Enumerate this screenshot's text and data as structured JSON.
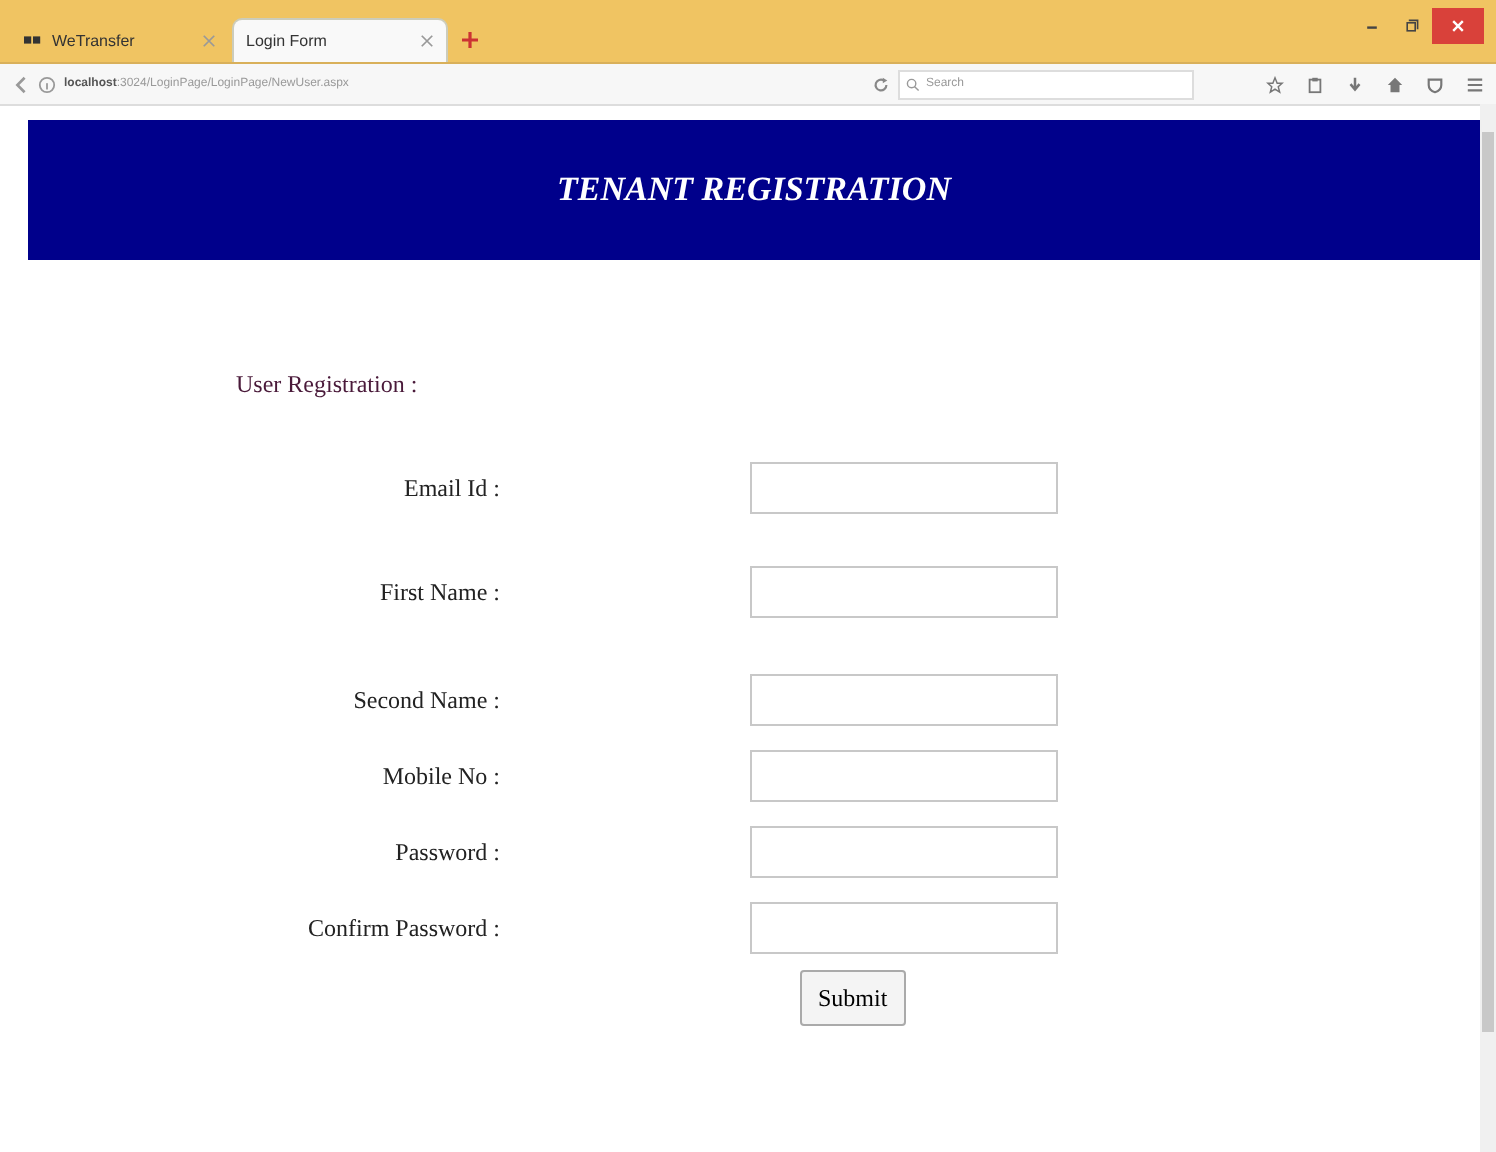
{
  "browser": {
    "tabs": [
      {
        "label": "WeTransfer",
        "selected": false
      },
      {
        "label": "Login Form",
        "selected": true
      }
    ],
    "address": {
      "host": "localhost",
      "path": ":3024/LoginPage/LoginPage/NewUser.aspx"
    },
    "search": {
      "placeholder": "Search"
    }
  },
  "banner": {
    "title": "TENANT REGISTRATION"
  },
  "form": {
    "heading": "User Registration :",
    "fields": [
      {
        "label": "Email Id :"
      },
      {
        "label": "First Name :"
      },
      {
        "label": "Second Name :"
      },
      {
        "label": "Mobile No :"
      },
      {
        "label": "Password :"
      },
      {
        "label": "Confirm Password :"
      }
    ],
    "submit": "Submit"
  }
}
